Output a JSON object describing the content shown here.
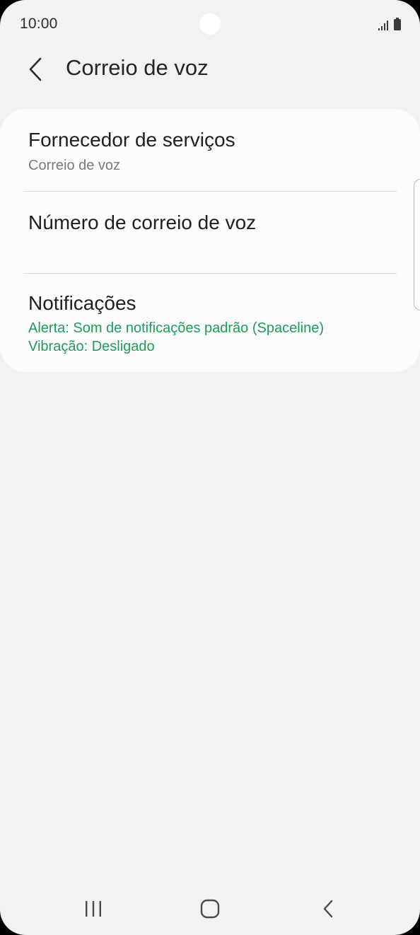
{
  "status_bar": {
    "time": "10:00",
    "icons": [
      "signal-icon",
      "battery-icon"
    ]
  },
  "header": {
    "back_icon": "chevron-left-icon",
    "title": "Correio de voz"
  },
  "settings": {
    "items": [
      {
        "title": "Fornecedor de serviços",
        "subtitle": "Correio de voz"
      },
      {
        "title": "Número de correio de voz"
      },
      {
        "title": "Notificações",
        "subtitle_lines": [
          "Alerta: Som de notificações padrão (Spaceline)",
          "Vibração: Desligado"
        ]
      }
    ]
  },
  "nav_bar": {
    "icons": [
      "recent-apps-icon",
      "home-icon",
      "back-icon"
    ]
  },
  "colors": {
    "background": "#f2f2f2",
    "card": "#fcfcfc",
    "accent_green": "#1e9c5a",
    "subtitle_gray": "#7a7a7a"
  }
}
